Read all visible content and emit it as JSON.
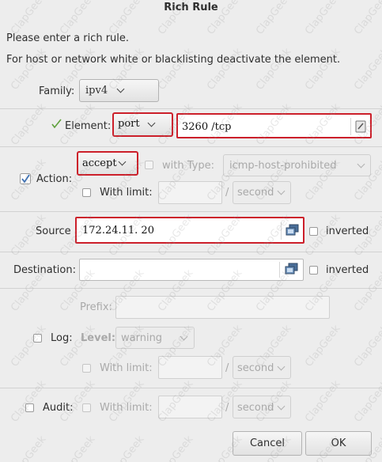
{
  "dialog": {
    "title": "Rich Rule",
    "intro_line1": "Please enter a rich rule.",
    "intro_line2": "For host or network white or blacklisting deactivate the element."
  },
  "family": {
    "label": "Family:",
    "value": "ipv4"
  },
  "element": {
    "label": "Element:",
    "type_value": "port",
    "value": "3260 /tcp"
  },
  "action": {
    "label": "Action:",
    "value": "accept",
    "with_type_label": "with Type:",
    "type_value": "icmp-host-prohibited",
    "with_limit_label": "With limit:",
    "limit_value": "",
    "limit_unit": "second"
  },
  "source": {
    "label": "Source",
    "value": "172.24.11. 20",
    "inverted_label": "inverted"
  },
  "destination": {
    "label": "Destination:",
    "value": "",
    "inverted_label": "inverted"
  },
  "log": {
    "prefix_label": "Prefix:",
    "label": "Log:",
    "level_label": "Level:",
    "level_value": "warning",
    "with_limit_label": "With limit:",
    "limit_unit": "second"
  },
  "audit": {
    "label": "Audit:",
    "with_limit_label": "With limit:",
    "limit_unit": "second"
  },
  "buttons": {
    "cancel": "Cancel",
    "ok": "OK"
  },
  "watermark": {
    "text": "ClapGeek"
  },
  "colors": {
    "highlight": "#cc1f2a",
    "checked": "#3a6fb4",
    "background": "#ededed"
  }
}
